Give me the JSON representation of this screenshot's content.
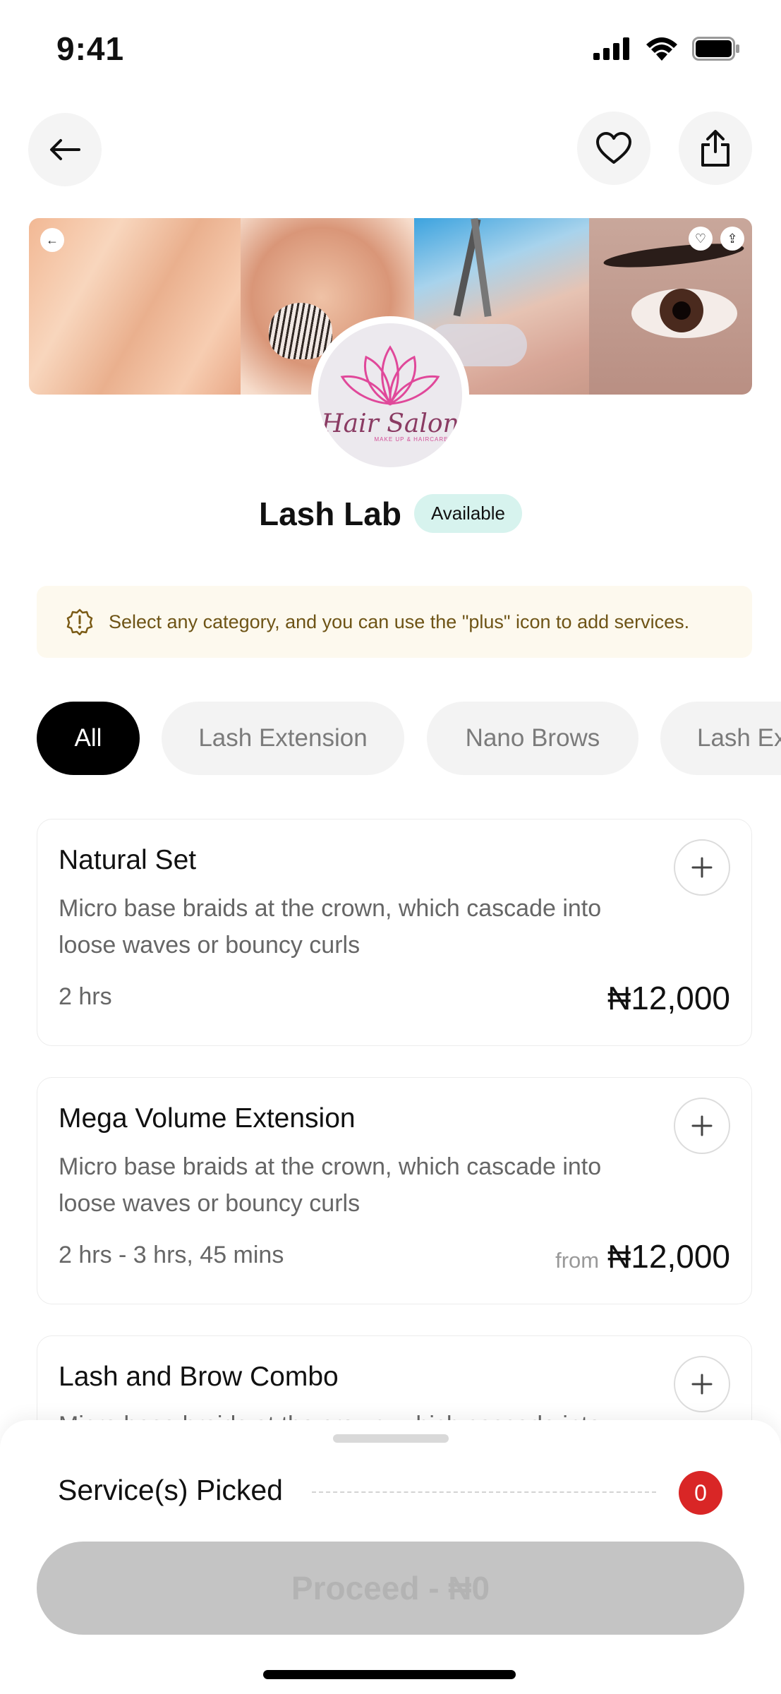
{
  "status_bar": {
    "time": "9:41",
    "icons": [
      "signal-icon",
      "wifi-icon",
      "battery-icon"
    ]
  },
  "header": {
    "back_icon": "arrow-left-icon",
    "favorite_icon": "heart-icon",
    "share_icon": "share-icon"
  },
  "banner": {
    "mini_icons": [
      "arrow-left-icon",
      "heart-icon",
      "share-icon"
    ]
  },
  "logo": {
    "title": "Hair Salon",
    "subtitle": "MAKE UP & HAIRCARE"
  },
  "shop": {
    "name": "Lash Lab",
    "status": "Available"
  },
  "info": {
    "icon": "alert-badge-icon",
    "text": "Select any category, and you can use the \"plus\" icon to add services."
  },
  "categories": [
    {
      "label": "All",
      "active": true
    },
    {
      "label": "Lash Extension",
      "active": false
    },
    {
      "label": "Nano Brows",
      "active": false
    },
    {
      "label": "Lash Ex",
      "active": false
    }
  ],
  "services": [
    {
      "name": "Natural Set",
      "description": "Micro base braids at the crown, which cascade into loose waves or bouncy curls",
      "duration": "2 hrs",
      "price_prefix": "",
      "price": "₦12,000"
    },
    {
      "name": "Mega Volume Extension",
      "description": "Micro base braids at the crown, which cascade into loose waves or bouncy curls",
      "duration": "2 hrs - 3 hrs, 45 mins",
      "price_prefix": "from",
      "price": "₦12,000"
    },
    {
      "name": "Lash and Brow  Combo",
      "description": "Micro base braids at the crown, which cascade into loose waves or bouncy curls",
      "duration": "",
      "price_prefix": "",
      "price": ""
    }
  ],
  "summary": {
    "label": "Service(s) Picked",
    "count": "0",
    "proceed_label": "Proceed - ₦0"
  },
  "colors": {
    "accent_black": "#000000",
    "badge_bg": "#d7f3ee",
    "info_bg": "#fdf9ee",
    "count_red": "#d92626",
    "disabled_button": "#c4c4c4"
  }
}
